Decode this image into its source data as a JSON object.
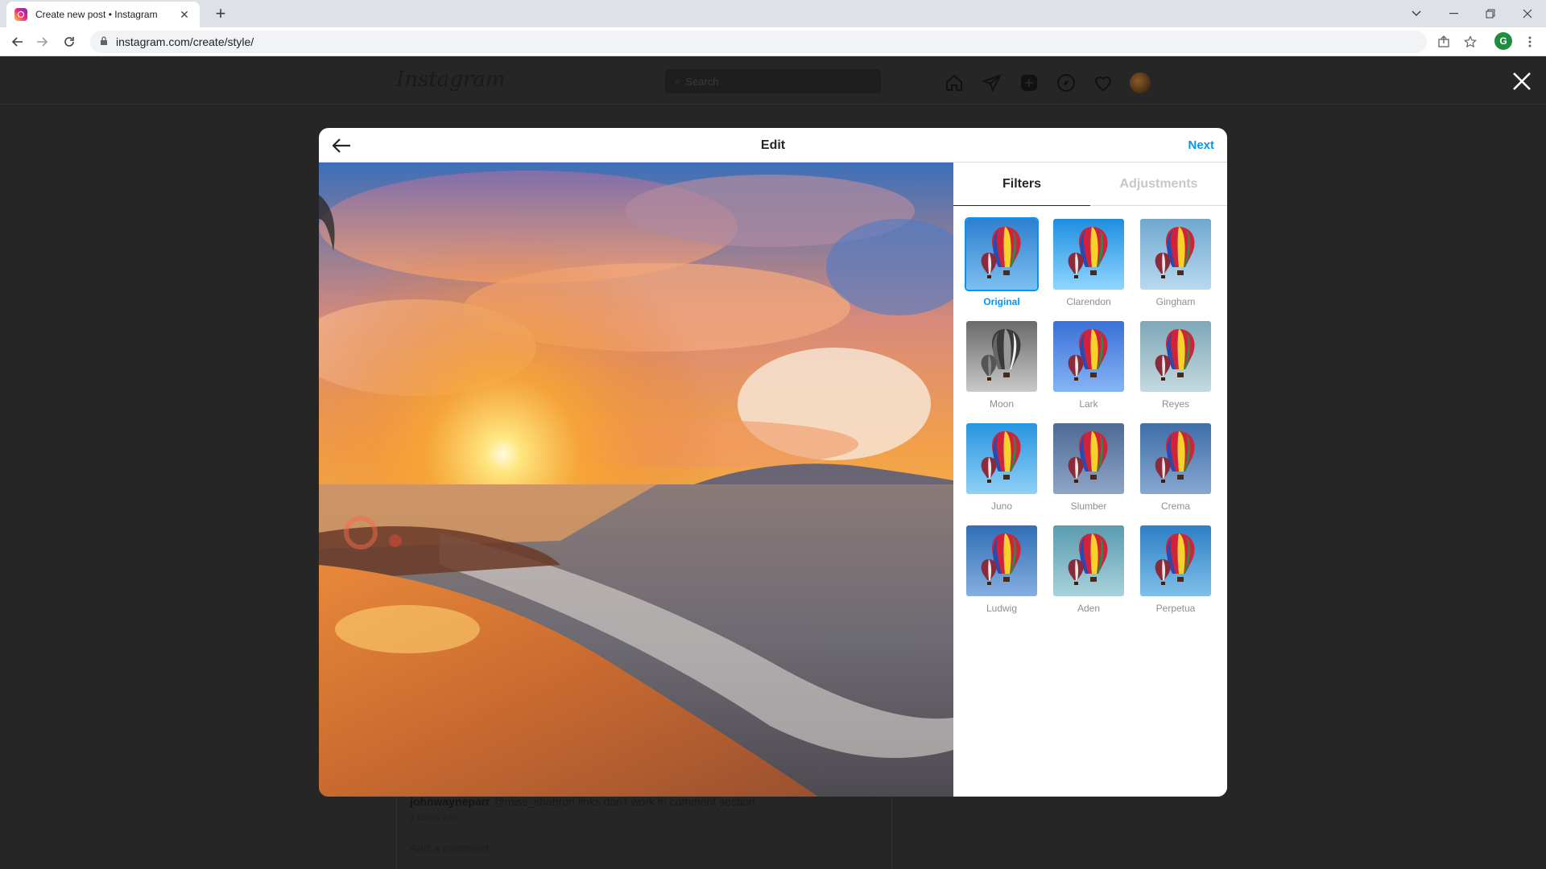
{
  "browser": {
    "tab_title": "Create new post • Instagram",
    "tab_close": "✕",
    "new_tab": "+",
    "url": "instagram.com/create/style/",
    "profile_initial": "G"
  },
  "background_page": {
    "logo": "Instagram",
    "search_placeholder": "Search",
    "comment_user": "johnwayneparr",
    "comment_text": "@miss_shahron links don't work in comment section",
    "comment_time": "2 DAYS AGO",
    "add_comment": "Add a comment..."
  },
  "modal": {
    "title": "Edit",
    "next_label": "Next",
    "tabs": [
      {
        "label": "Filters",
        "active": true
      },
      {
        "label": "Adjustments",
        "active": false
      }
    ],
    "filters": [
      {
        "name": "Original",
        "selected": true,
        "sky": [
          "#2f7fd0",
          "#7cc0f0"
        ],
        "gray": false
      },
      {
        "name": "Clarendon",
        "selected": false,
        "sky": [
          "#1e8ee0",
          "#8fd6ff"
        ],
        "gray": false
      },
      {
        "name": "Gingham",
        "selected": false,
        "sky": [
          "#6fa8d0",
          "#b9d9ee"
        ],
        "gray": false
      },
      {
        "name": "Moon",
        "selected": false,
        "sky": [
          "#6a6a6a",
          "#c9c9c9"
        ],
        "gray": true
      },
      {
        "name": "Lark",
        "selected": false,
        "sky": [
          "#3a70d8",
          "#86b4f5"
        ],
        "gray": false
      },
      {
        "name": "Reyes",
        "selected": false,
        "sky": [
          "#7fa8b8",
          "#c3d9df"
        ],
        "gray": false
      },
      {
        "name": "Juno",
        "selected": false,
        "sky": [
          "#2895e0",
          "#8fd0f5"
        ],
        "gray": false
      },
      {
        "name": "Slumber",
        "selected": false,
        "sky": [
          "#4d6a95",
          "#8ea6c6"
        ],
        "gray": false
      },
      {
        "name": "Crema",
        "selected": false,
        "sky": [
          "#3f6ea8",
          "#86a8d0"
        ],
        "gray": false
      },
      {
        "name": "Ludwig",
        "selected": false,
        "sky": [
          "#2f6fb5",
          "#86aee0"
        ],
        "gray": false
      },
      {
        "name": "Aden",
        "selected": false,
        "sky": [
          "#5a9cb0",
          "#a8d2db"
        ],
        "gray": false
      },
      {
        "name": "Perpetua",
        "selected": false,
        "sky": [
          "#2e7fc6",
          "#7fc0e8"
        ],
        "gray": false
      }
    ]
  },
  "colors": {
    "accent": "#0095f6",
    "overlay": "#262626"
  }
}
